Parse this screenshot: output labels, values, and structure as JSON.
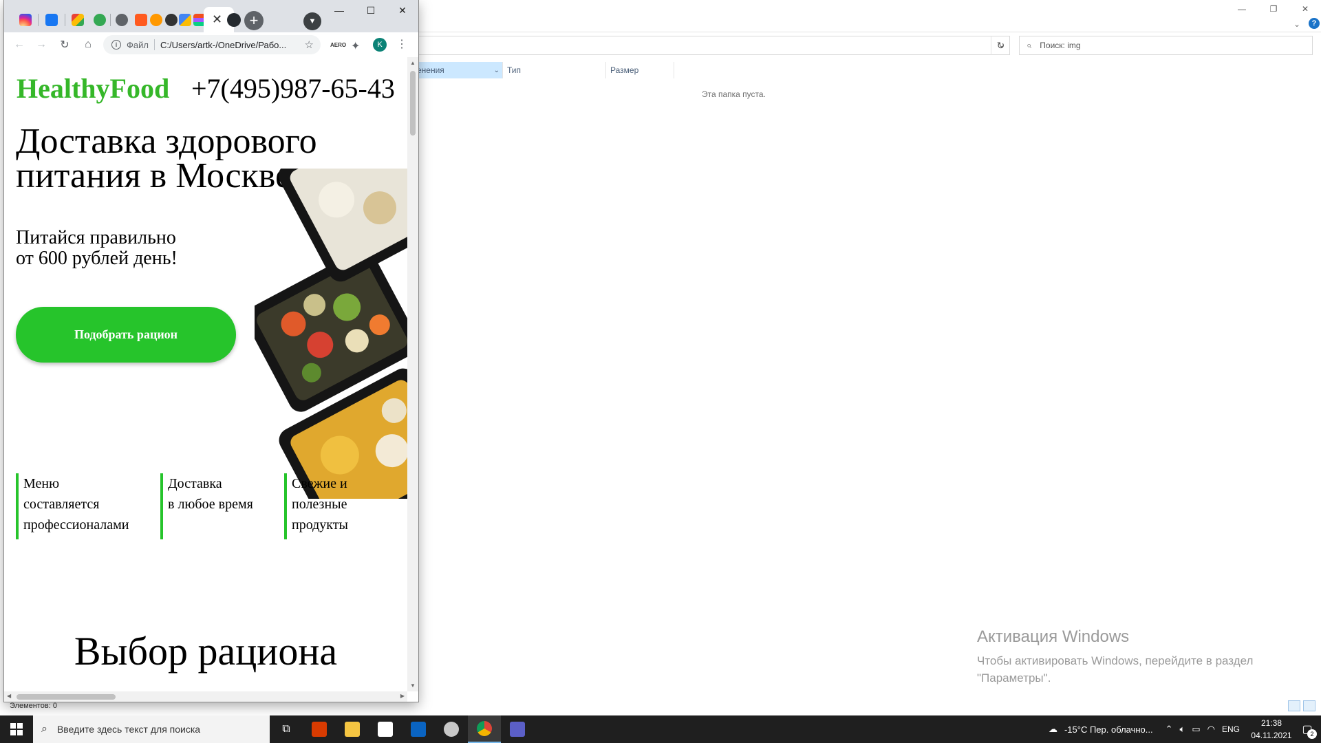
{
  "explorer": {
    "search_placeholder": "Поиск: img",
    "col_date": "енения",
    "col_type": "Тип",
    "col_size": "Размер",
    "empty_text": "Эта папка пуста.",
    "status": "Элементов: 0"
  },
  "activation": {
    "title": "Активация Windows",
    "text_line1": "Чтобы активировать Windows, перейдите в раздел",
    "text_line2": "\"Параметры\"."
  },
  "browser": {
    "omnibox_scheme": "Файл",
    "omnibox_url": "C:/Users/artk-/OneDrive/Рабо...",
    "avatar_letter": "K",
    "extension_label": "AERO",
    "tab_icons": [
      "instagram-icon",
      "messenger-icon",
      "gmail-icon",
      "tab-icon",
      "tab-icon",
      "tab-icon",
      "tab-icon",
      "tab-icon",
      "tab-icon",
      "figma-icon"
    ]
  },
  "page": {
    "logo": "HealthyFood",
    "phone": "+7(495)987-65-43",
    "hero_title": "Доставка здорового питания в Москве",
    "hero_sub_line1": "Питайся правильно",
    "hero_sub_line2": "от 600 рублей день!",
    "cta_label": "Подобрать рацион",
    "features": [
      {
        "lines": [
          "Меню",
          "составляется",
          "профессионалами"
        ]
      },
      {
        "lines": [
          "Доставка",
          "в любое время"
        ]
      },
      {
        "lines": [
          "Свежие и",
          "полезные",
          "продукты"
        ]
      }
    ],
    "section_title": "Выбор рациона"
  },
  "taskbar": {
    "search_placeholder": "Введите здесь текст для поиска",
    "weather": "-15°C  Пер. облачно...",
    "lang": "ENG",
    "time": "21:38",
    "date": "04.11.2021",
    "notifications": "2"
  },
  "colors": {
    "brand_green": "#35b729",
    "cta_green": "#26c42b",
    "taskbar": "#1f1f1f"
  }
}
